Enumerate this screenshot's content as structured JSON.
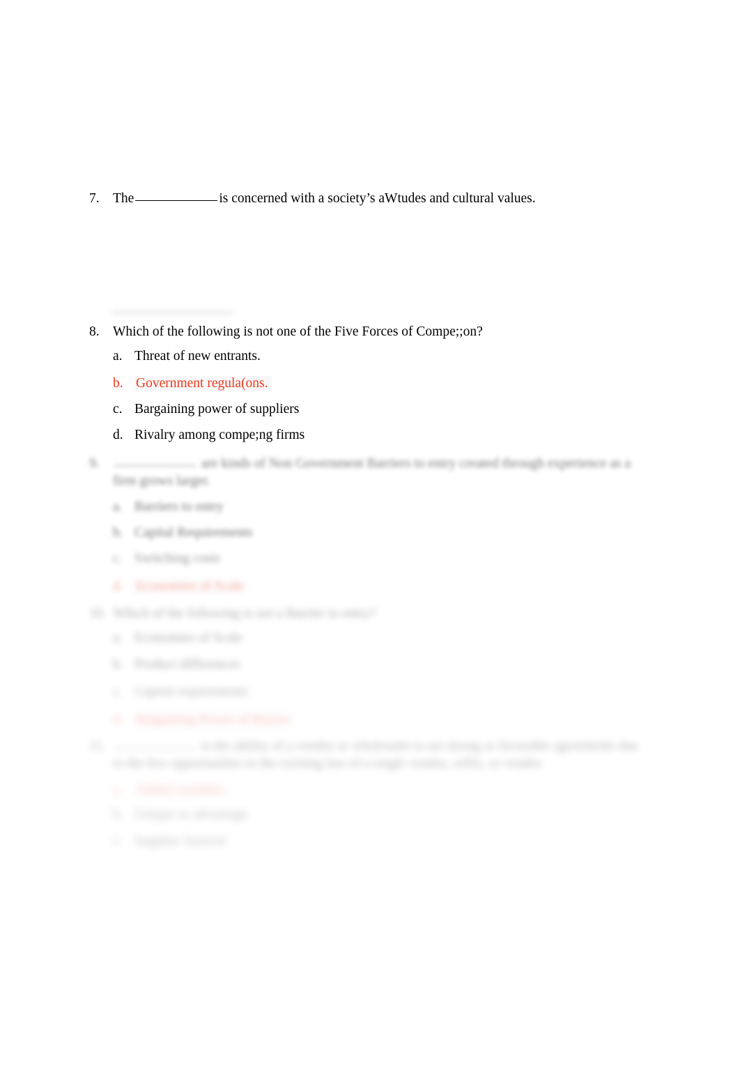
{
  "document": {
    "type": "multiple-choice-quiz-page",
    "accent_correct_answer_color": "#ee3b1f",
    "body_text_color": "#000000",
    "page_background": "#ffffff"
  },
  "questions": [
    {
      "number": "7.",
      "text_before_blank": "The",
      "text_after_blank": "is concerned with a society’s aWtudes and cultural values.",
      "options": []
    },
    {
      "number": "8.",
      "text": "Which of the following is not one of the Five Forces of Compe;;on?",
      "options": [
        {
          "letter": "a.",
          "text": "Threat of new entrants."
        },
        {
          "letter": "b.",
          "text": "Government regula(ons."
        },
        {
          "letter": "c.",
          "text": "Bargaining power of suppliers"
        },
        {
          "letter": "d.",
          "text": "Rivalry among compe;ng firms"
        }
      ]
    },
    {
      "number": "9.",
      "text_line_1": "are kinds of Non Government Barriers to entry created through experience as a",
      "text_line_2": "firm grows larger.",
      "options": [
        {
          "letter": "a.",
          "text": "Barriers to entry"
        },
        {
          "letter": "b.",
          "text": "Capital Requirements"
        },
        {
          "letter": "c.",
          "text": "Switching costs"
        },
        {
          "letter": "d.",
          "text": "Economies of Scale"
        }
      ]
    },
    {
      "number": "10.",
      "text": "Which of the following is not a Barrier to entry?",
      "options": [
        {
          "letter": "a.",
          "text": "Economies of Scale"
        },
        {
          "letter": "b.",
          "text": "Product differences"
        },
        {
          "letter": "c.",
          "text": "Capital requirements"
        },
        {
          "letter": "d.",
          "text": "Bargaining Power of Buyers"
        }
      ]
    },
    {
      "number": "11.",
      "text_line_1": "is the ability of a vendor or wholesaler to set strong or favorable agreements due",
      "text_line_2": "to the few opportunities in the existing law of a single vendor, seller, or vendor.",
      "options": [
        {
          "letter": "a.",
          "text": "Added variables"
        },
        {
          "letter": "b.",
          "text": "Unique or advantage"
        },
        {
          "letter": "c.",
          "text": "Supplier Sources"
        }
      ]
    }
  ]
}
